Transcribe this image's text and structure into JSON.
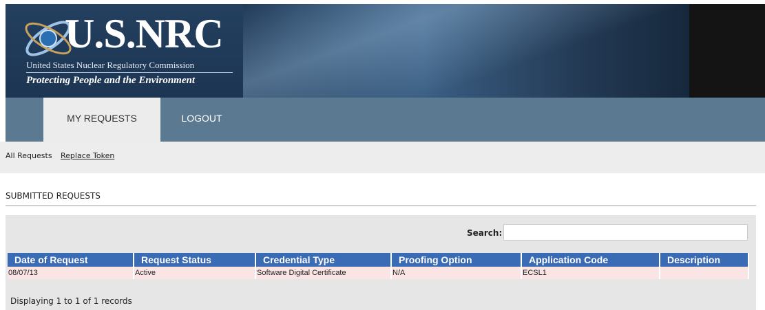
{
  "header": {
    "logo_text": "U.S.NRC",
    "org_name": "United States Nuclear Regulatory Commission",
    "tagline": "Protecting People and the Environment"
  },
  "nav": {
    "tabs": [
      {
        "label": "MY REQUESTS",
        "active": true
      },
      {
        "label": "LOGOUT",
        "active": false
      }
    ]
  },
  "subnav": {
    "all_requests": "All Requests",
    "replace_token": "Replace Token"
  },
  "section": {
    "title": "SUBMITTED REQUESTS"
  },
  "search": {
    "label": "Search:",
    "value": ""
  },
  "table": {
    "columns": [
      "Date of Request",
      "Request Status",
      "Credential Type",
      "Proofing Option",
      "Application Code",
      "Description"
    ],
    "rows": [
      [
        "08/07/13",
        "Active",
        "Software Digital Certificate",
        "N/A",
        "ECSL1",
        ""
      ]
    ]
  },
  "footer": {
    "info": "Displaying 1 to 1 of 1 records"
  },
  "colors": {
    "header_blue": "#3a6bb5",
    "row_pink": "#fbe4e4",
    "nav_bg": "#5b7a92"
  }
}
